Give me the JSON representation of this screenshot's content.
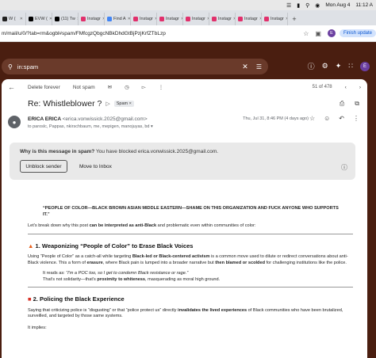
{
  "menubar": {
    "date": "Mon Aug 4",
    "time": "11:12 A"
  },
  "tabs": [
    {
      "label": "W (",
      "color": "#222222",
      "active": false
    },
    {
      "label": "EVW (",
      "color": "#000000",
      "active": false
    },
    {
      "label": "(11) Tw",
      "color": "#000000",
      "active": false
    },
    {
      "label": "Instagr",
      "color": "#e1306c",
      "active": false
    },
    {
      "label": "Find A",
      "color": "#4285f4",
      "active": false
    },
    {
      "label": "Instagr",
      "color": "#e1306c",
      "active": false
    },
    {
      "label": "Instagr",
      "color": "#e1306c",
      "active": false
    },
    {
      "label": "Instagr",
      "color": "#e1306c",
      "active": false
    },
    {
      "label": "Instagr",
      "color": "#e1306c",
      "active": false
    },
    {
      "label": "Instagr",
      "color": "#e1306c",
      "active": false
    },
    {
      "label": "Instagr",
      "color": "#e1306c",
      "active": false
    }
  ],
  "address": {
    "url": "m/mail/u/0/?tab=rm&ogbl#spam/FMfcgzQbgcNBkDhdGtBjPzjKrfZTbLzp",
    "profile_initial": "E",
    "finish_update": "Finish update"
  },
  "search": {
    "query": "in:spam"
  },
  "header": {
    "avatar_initial": "E"
  },
  "toolbar": {
    "delete_forever": "Delete forever",
    "not_spam": "Not spam",
    "pagination": "51 of 478"
  },
  "email": {
    "subject": "Re: Whistleblower ?",
    "label": "Spam",
    "sender_name": "ERICA ERICA",
    "sender_email": "<erica.vonwissick.2025@gmail.com>",
    "recipients": "to paroslc, Pappas, nkirschbaum, me, mepigen, manojuyas, bd",
    "date": "Thu, Jul 31, 8:46 PM (4 days ago)"
  },
  "spam_notice": {
    "question": "Why is this message in spam?",
    "reason": " You have blocked erica.vonwissick.2025@gmail.com.",
    "unblock_label": "Unblock sender",
    "move_label": "Move to Inbox"
  },
  "body": {
    "headline": "“PEOPLE OF COLOR—BLACK BROWN ASIAN MIDDLE EASTERN—SHAME ON THIS ORGANIZATION AND FUCK ANYONE WHO SUPPORTS IT.”",
    "intro_a": "Let's break down why this post ",
    "intro_b": "can be interpreted as anti-Black",
    "intro_c": " and problematic even within communities of color:",
    "s1_title": "1. Weaponizing “People of Color” to Erase Black Voices",
    "s1_a": "Using “People of Color” as a catch-all while targeting ",
    "s1_b": "Black-led or Black-centered activism",
    "s1_c": " is a common move used to dilute or redirect conversations about anti-Black violence. This a form of ",
    "s1_d": "erasure",
    "s1_e": ", where Black pain is lumped into a broader narrative but ",
    "s1_f": "then blamed or scolded",
    "s1_g": " for challenging institutions like the police.",
    "s1_quote_prefix": "It reads as: ",
    "s1_quote": "“I'm a POC too, so I get to condemn Black resistance or rage.”",
    "s1_quote2_a": "That's not solidarity—that's ",
    "s1_quote2_b": "proximity to whiteness",
    "s1_quote2_c": ", masquerading as moral high ground.",
    "s2_title": "2. Policing the Black Experience",
    "s2_a": "Saying that criticizing police is “disgusting” or that “police protect us” directly ",
    "s2_b": "invalidates the lived experiences",
    "s2_c": " of Black communities who have been brutalized, surveilled, and targeted by those same systems.",
    "s2_implies": "It implies:"
  }
}
